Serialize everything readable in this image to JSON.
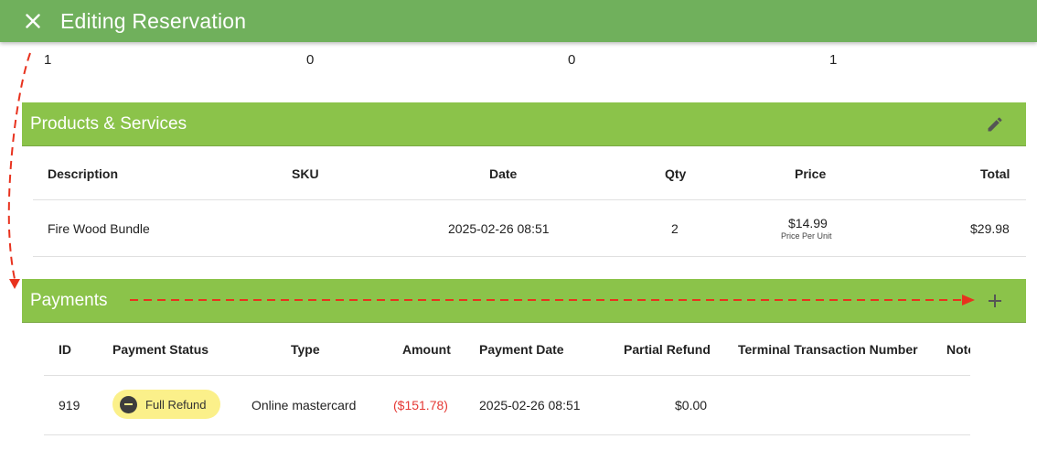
{
  "header": {
    "title": "Editing Reservation",
    "close_icon": "close-icon"
  },
  "counts": [
    "1",
    "0",
    "0",
    "1"
  ],
  "products": {
    "title": "Products & Services",
    "action_icon": "pencil-icon",
    "columns": [
      "Description",
      "SKU",
      "Date",
      "Qty",
      "Price",
      "Total"
    ],
    "rows": [
      {
        "description": "Fire Wood Bundle",
        "sku": "",
        "date": "2025-02-26 08:51",
        "qty": "2",
        "price": "$14.99",
        "price_note": "Price Per Unit",
        "total": "$29.98"
      }
    ]
  },
  "payments": {
    "title": "Payments",
    "action_icon": "plus-icon",
    "columns": [
      "ID",
      "Payment Status",
      "Type",
      "Amount",
      "Payment Date",
      "Partial Refund",
      "Terminal Transaction Number",
      "Note"
    ],
    "rows": [
      {
        "id": "919",
        "status": "Full Refund",
        "type": "Online mastercard",
        "amount": "($151.78)",
        "date": "2025-02-26 08:51",
        "partial_refund": "$0.00",
        "terminal_txn": "",
        "note": ""
      }
    ]
  },
  "colors": {
    "topbar": "#70b05c",
    "section": "#8bc34a",
    "refund_chip": "#fbf08a",
    "negative_amount": "#e53935",
    "annotation": "#e8321e"
  }
}
